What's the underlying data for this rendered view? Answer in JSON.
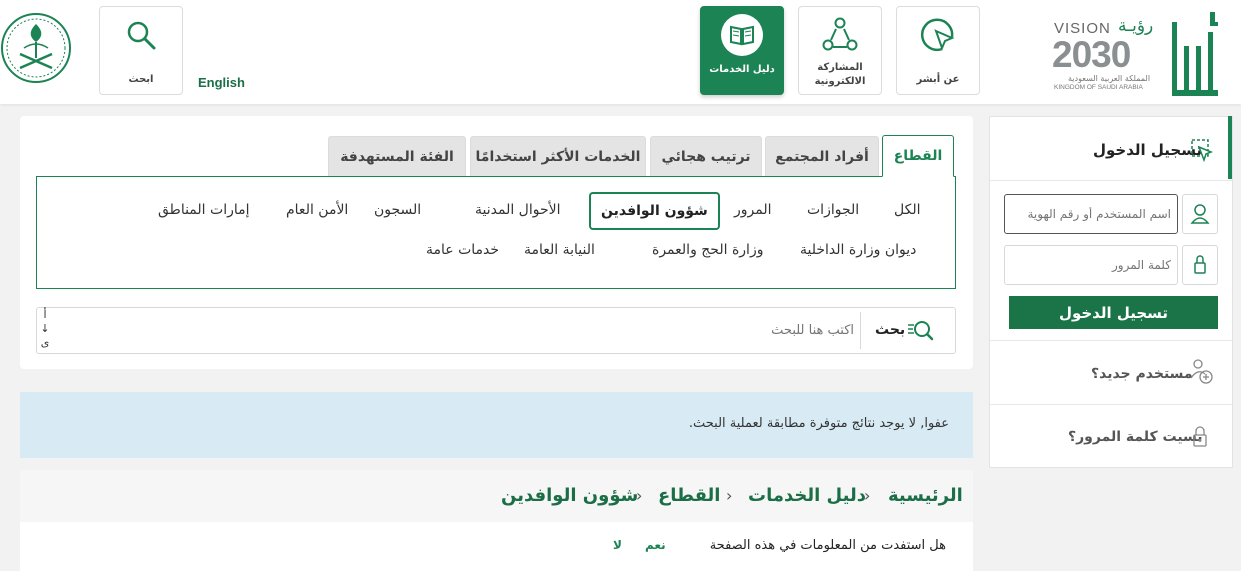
{
  "header": {
    "brand": {
      "vision_en": "VISION",
      "vision_ar": "رؤيـة",
      "year": "2030",
      "kingdom_ar": "المملكة العربية السعودية",
      "kingdom_en": "KINGDOM OF SAUDI ARABIA",
      "logo_icon": "absher-logo-icon",
      "emblem_icon": "saudi-emblem-icon"
    },
    "nav": [
      {
        "label": "عن أبشر",
        "icon": "cursor-pointer-icon"
      },
      {
        "label": "المشاركة الالكترونية",
        "icon": "network-people-icon"
      },
      {
        "label": "دليل الخدمات",
        "icon": "book-icon",
        "active": true
      }
    ],
    "language_link": "English",
    "search_label": "ابحث"
  },
  "tabs": [
    {
      "label": "القطاع",
      "active": true
    },
    {
      "label": "أفراد المجتمع"
    },
    {
      "label": "ترتيب هجائي"
    },
    {
      "label": "الخدمات الأكثر استخدامًا"
    },
    {
      "label": "الفئة المستهدفة"
    }
  ],
  "categories_row1": [
    {
      "label": "الكل"
    },
    {
      "label": "الجوازات"
    },
    {
      "label": "المرور"
    },
    {
      "label": "شؤون الوافدين",
      "selected": true
    },
    {
      "label": "الأحوال المدنية"
    },
    {
      "label": "السجون"
    },
    {
      "label": "الأمن العام"
    },
    {
      "label": "إمارات المناطق"
    }
  ],
  "categories_row2": [
    {
      "label": "ديوان وزارة الداخلية"
    },
    {
      "label": "وزارة الحج والعمرة"
    },
    {
      "label": "النيابة العامة"
    },
    {
      "label": "خدمات عامة"
    }
  ],
  "search": {
    "label": "بحث",
    "placeholder": "اكتب هنا للبحث",
    "sort_chars": [
      "أ",
      "↓",
      "ى"
    ]
  },
  "results": {
    "no_results": "عفوا, لا يوجد نتائج متوفرة مطابقة لعملية البحث."
  },
  "breadcrumb": [
    "الرئيسية",
    "دليل الخدمات",
    "القطاع",
    "شؤون الوافدين"
  ],
  "breadcrumb_separator": "›",
  "feedback": {
    "question": "هل استفدت من المعلومات في هذه الصفحة",
    "yes": "نعم",
    "no": "لا"
  },
  "login": {
    "title": "تسجيل الدخول",
    "username_placeholder": "اسم المستخدم أو رقم الهوية",
    "password_placeholder": "كلمة المرور",
    "submit": "تسجيل الدخول",
    "new_user": "مستخدم جديد؟",
    "forgot_password": "نسيت كلمة المرور؟"
  },
  "colors": {
    "brand_green": "#1b8354",
    "info_blue": "#d8ebf5"
  }
}
